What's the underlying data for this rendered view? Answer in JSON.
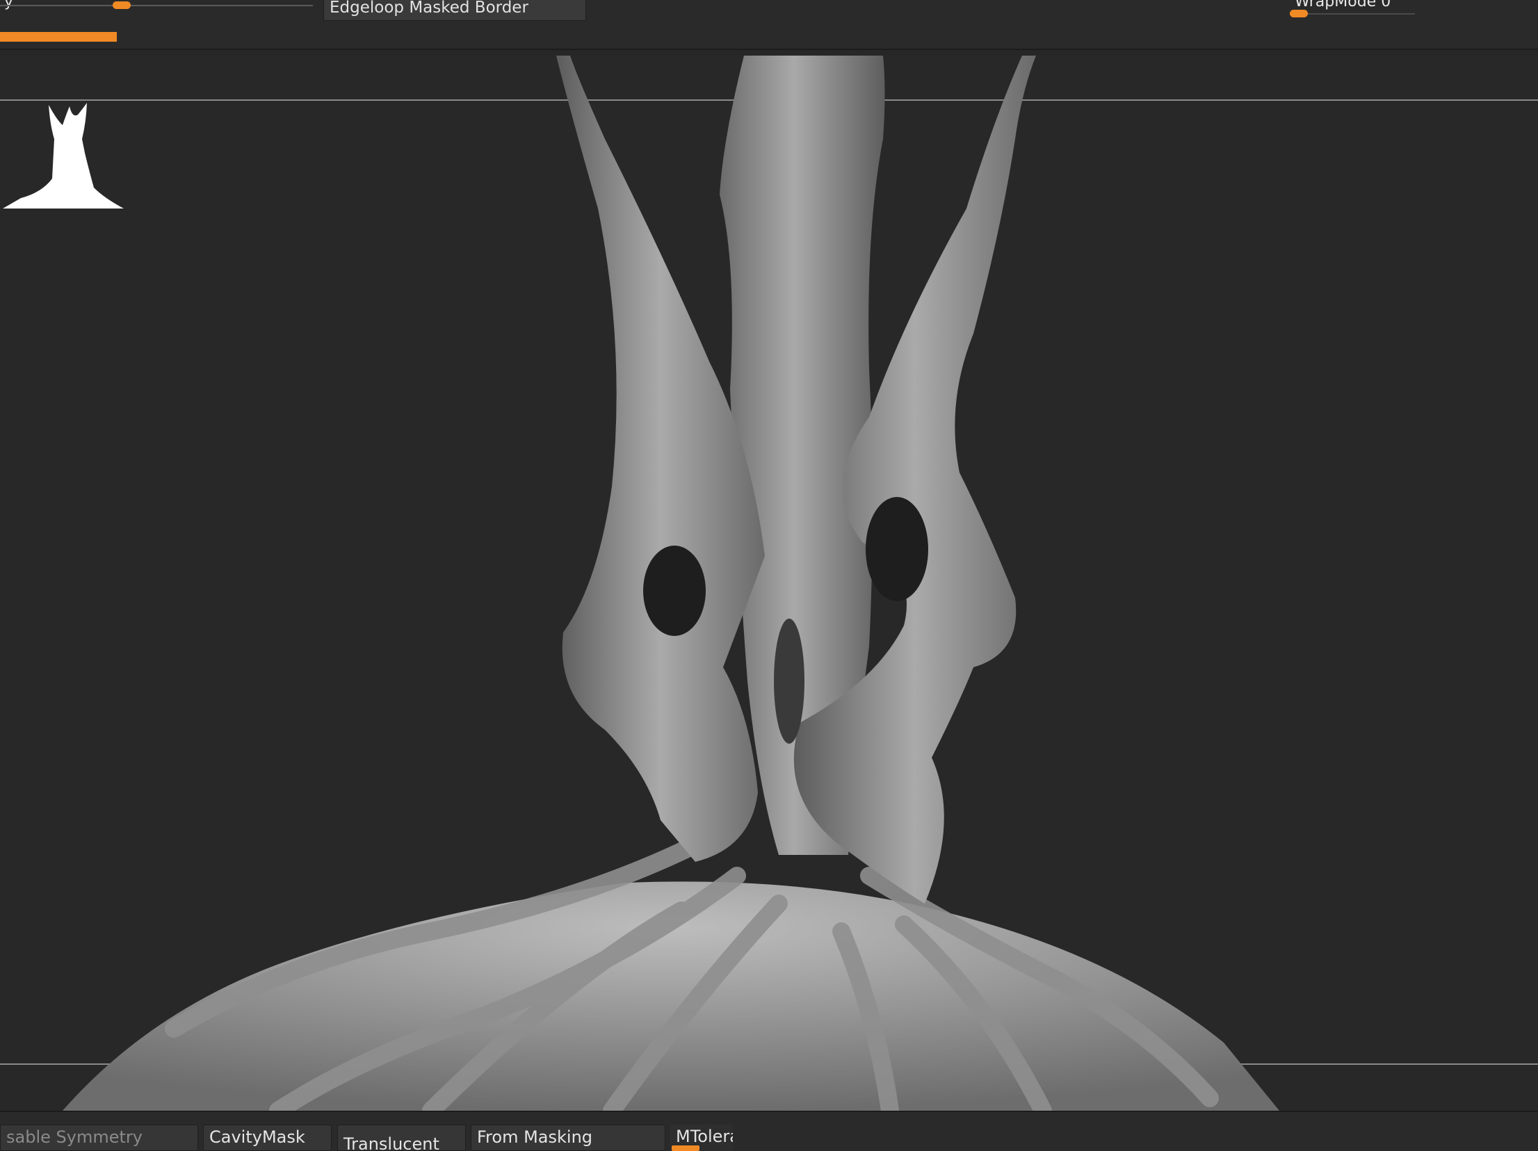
{
  "toolbar": {
    "top_left_label": "y",
    "edgeloop_button": "Edgeloop Masked Border",
    "wrapmode_label": "WrapMode",
    "wrapmode_value": "0",
    "progress_fraction": 0.076
  },
  "viewport": {
    "thumbnail_icon": "tree-silhouette-icon",
    "model_icon": "sculpted-tree-roots"
  },
  "bottom_toolbar": {
    "items": [
      "sable Symmetry",
      "CavityMask",
      "Translucent",
      "From Masking",
      "MToleran"
    ]
  },
  "colors": {
    "accent": "#f08a24",
    "background": "#272727",
    "panel": "#2a2a2a",
    "model": "#9a9a9a"
  }
}
